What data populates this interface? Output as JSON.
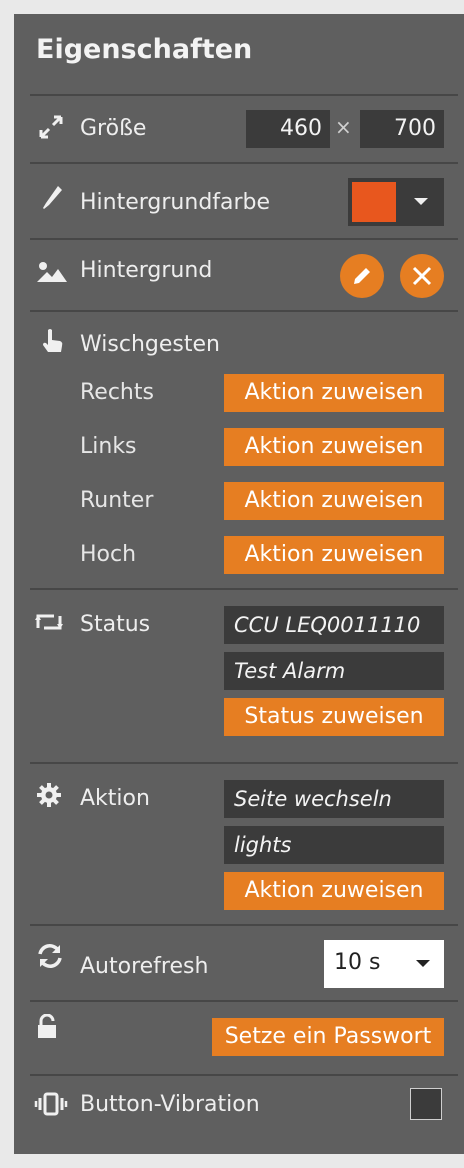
{
  "panel": {
    "title": "Eigenschaften"
  },
  "size": {
    "label": "Größe",
    "width": "460",
    "times": "×",
    "height": "700"
  },
  "bgcolor": {
    "label": "Hintergrundfarbe",
    "swatch": "#e8571e"
  },
  "background": {
    "label": "Hintergrund"
  },
  "gestures": {
    "label": "Wischgesten",
    "items": [
      {
        "label": "Rechts",
        "button": "Aktion zuweisen"
      },
      {
        "label": "Links",
        "button": "Aktion zuweisen"
      },
      {
        "label": "Runter",
        "button": "Aktion zuweisen"
      },
      {
        "label": "Hoch",
        "button": "Aktion zuweisen"
      }
    ]
  },
  "status": {
    "label": "Status",
    "field1": "CCU LEQ0011110",
    "field2": "Test Alarm",
    "button": "Status zuweisen"
  },
  "action": {
    "label": "Aktion",
    "field1": "Seite wechseln",
    "field2": "lights",
    "button": "Aktion zuweisen"
  },
  "autorefresh": {
    "label": "Autorefresh",
    "value": "10 s"
  },
  "password": {
    "button": "Setze ein Passwort"
  },
  "vibration": {
    "label": "Button-Vibration",
    "checked": false
  },
  "colors": {
    "accent": "#e67e22",
    "panel": "#5f5f5f",
    "field": "#3b3b3b"
  }
}
